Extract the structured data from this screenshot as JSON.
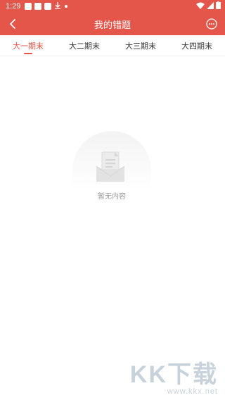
{
  "status_bar": {
    "time": "1:29",
    "icons": [
      "notification-square-icon",
      "cat-icon",
      "notification-square-icon",
      "download-icon",
      "dot-icon"
    ],
    "right_icons": [
      "wifi-icon",
      "signal-icon",
      "battery-icon"
    ]
  },
  "app_bar": {
    "title": "我的错题",
    "back_icon": "chevron-left-icon",
    "more_icon": "more-circle-icon",
    "color": "#e4564a"
  },
  "tabs": [
    {
      "label": "大一期末",
      "active": true
    },
    {
      "label": "大二期末",
      "active": false
    },
    {
      "label": "大三期末",
      "active": false
    },
    {
      "label": "大四期末",
      "active": false
    }
  ],
  "empty_state": {
    "icon": "empty-inbox-icon",
    "text": "暂无内容"
  },
  "watermark": {
    "logo": "KK下载",
    "url": "www.kkx.net"
  }
}
